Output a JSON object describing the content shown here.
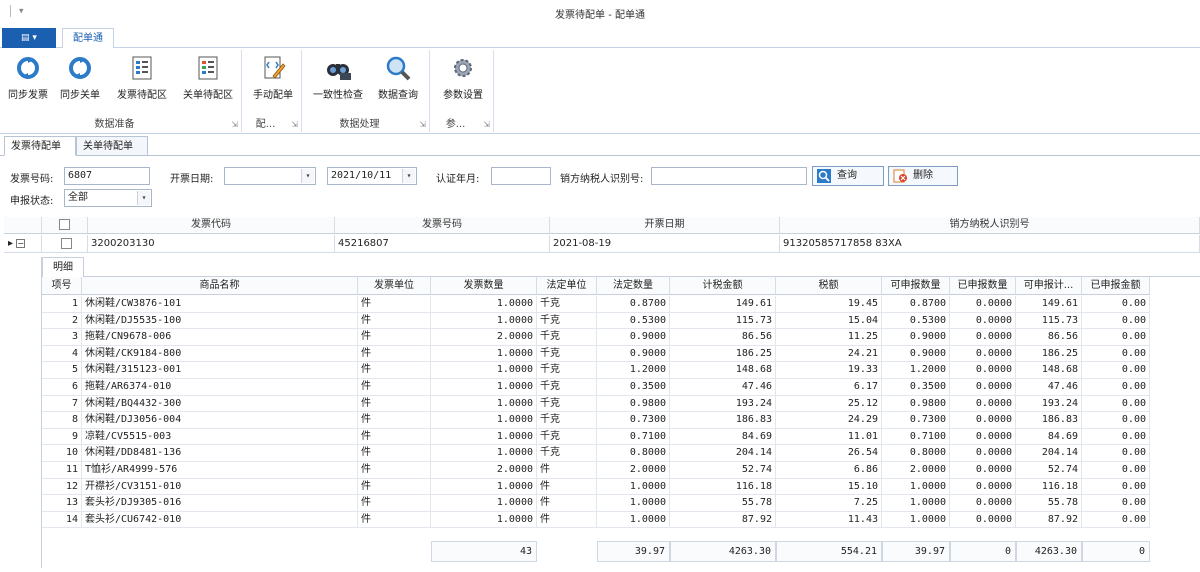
{
  "window": {
    "title": "发票待配单 - 配单通",
    "qat": "▾"
  },
  "ribbon": {
    "app_button": "▤ ▾",
    "active_tab": "配单通",
    "groups": [
      {
        "label": "数据准备",
        "buttons": [
          "同步发票",
          "同步关单",
          "发票待配区",
          "关单待配区"
        ]
      },
      {
        "label": "配...",
        "buttons": [
          "手动配单"
        ]
      },
      {
        "label": "数据处理",
        "buttons": [
          "一致性检查",
          "数据查询"
        ]
      },
      {
        "label": "参...",
        "buttons": [
          "参数设置"
        ]
      }
    ]
  },
  "page_tabs": [
    "发票待配单",
    "关单待配单"
  ],
  "filter": {
    "invoice_no_label": "发票号码:",
    "invoice_no_value": "6807",
    "date_label": "开票日期:",
    "date_from": "",
    "date_to": "2021/10/11",
    "auth_month_label": "认证年月:",
    "auth_month_value": "",
    "seller_tax_label": "销方纳税人识别号:",
    "seller_tax_value": "",
    "query_button": "查询",
    "delete_button": "删除",
    "status_label": "申报状态:",
    "status_value": "全部"
  },
  "master": {
    "headers": [
      "发票代码",
      "发票号码",
      "开票日期",
      "销方纳税人识别号"
    ],
    "row": [
      "3200203130",
      "45216807",
      "2021-08-19",
      "91320585717858 83XA"
    ]
  },
  "detail": {
    "tab": "明细",
    "headers": [
      "项号",
      "商品名称",
      "发票单位",
      "发票数量",
      "法定单位",
      "法定数量",
      "计税金额",
      "税额",
      "可申报数量",
      "已申报数量",
      "可申报计...",
      "已申报金额"
    ],
    "rows": [
      [
        "1",
        "休闲鞋/CW3876-101",
        "件",
        "1.0000",
        "千克",
        "0.8700",
        "149.61",
        "19.45",
        "0.8700",
        "0.0000",
        "149.61",
        "0.00"
      ],
      [
        "2",
        "休闲鞋/DJ5535-100",
        "件",
        "1.0000",
        "千克",
        "0.5300",
        "115.73",
        "15.04",
        "0.5300",
        "0.0000",
        "115.73",
        "0.00"
      ],
      [
        "3",
        "拖鞋/CN9678-006",
        "件",
        "2.0000",
        "千克",
        "0.9000",
        "86.56",
        "11.25",
        "0.9000",
        "0.0000",
        "86.56",
        "0.00"
      ],
      [
        "4",
        "休闲鞋/CK9184-800",
        "件",
        "1.0000",
        "千克",
        "0.9000",
        "186.25",
        "24.21",
        "0.9000",
        "0.0000",
        "186.25",
        "0.00"
      ],
      [
        "5",
        "休闲鞋/315123-001",
        "件",
        "1.0000",
        "千克",
        "1.2000",
        "148.68",
        "19.33",
        "1.2000",
        "0.0000",
        "148.68",
        "0.00"
      ],
      [
        "6",
        "拖鞋/AR6374-010",
        "件",
        "1.0000",
        "千克",
        "0.3500",
        "47.46",
        "6.17",
        "0.3500",
        "0.0000",
        "47.46",
        "0.00"
      ],
      [
        "7",
        "休闲鞋/BQ4432-300",
        "件",
        "1.0000",
        "千克",
        "0.9800",
        "193.24",
        "25.12",
        "0.9800",
        "0.0000",
        "193.24",
        "0.00"
      ],
      [
        "8",
        "休闲鞋/DJ3056-004",
        "件",
        "1.0000",
        "千克",
        "0.7300",
        "186.83",
        "24.29",
        "0.7300",
        "0.0000",
        "186.83",
        "0.00"
      ],
      [
        "9",
        "凉鞋/CV5515-003",
        "件",
        "1.0000",
        "千克",
        "0.7100",
        "84.69",
        "11.01",
        "0.7100",
        "0.0000",
        "84.69",
        "0.00"
      ],
      [
        "10",
        "休闲鞋/DD8481-136",
        "件",
        "1.0000",
        "千克",
        "0.8000",
        "204.14",
        "26.54",
        "0.8000",
        "0.0000",
        "204.14",
        "0.00"
      ],
      [
        "11",
        "T恤衫/AR4999-576",
        "件",
        "2.0000",
        "件",
        "2.0000",
        "52.74",
        "6.86",
        "2.0000",
        "0.0000",
        "52.74",
        "0.00"
      ],
      [
        "12",
        "开襟衫/CV3151-010",
        "件",
        "1.0000",
        "件",
        "1.0000",
        "116.18",
        "15.10",
        "1.0000",
        "0.0000",
        "116.18",
        "0.00"
      ],
      [
        "13",
        "套头衫/DJ9305-016",
        "件",
        "1.0000",
        "件",
        "1.0000",
        "55.78",
        "7.25",
        "1.0000",
        "0.0000",
        "55.78",
        "0.00"
      ],
      [
        "14",
        "套头衫/CU6742-010",
        "件",
        "1.0000",
        "件",
        "1.0000",
        "87.92",
        "11.43",
        "1.0000",
        "0.0000",
        "87.92",
        "0.00"
      ]
    ],
    "totals": {
      "qty": "43",
      "legal_qty": "39.97",
      "amount": "4263.30",
      "tax": "554.21",
      "avail_qty": "39.97",
      "declared_qty": "0",
      "avail_amt": "4263.30",
      "declared_amt": "0"
    }
  }
}
